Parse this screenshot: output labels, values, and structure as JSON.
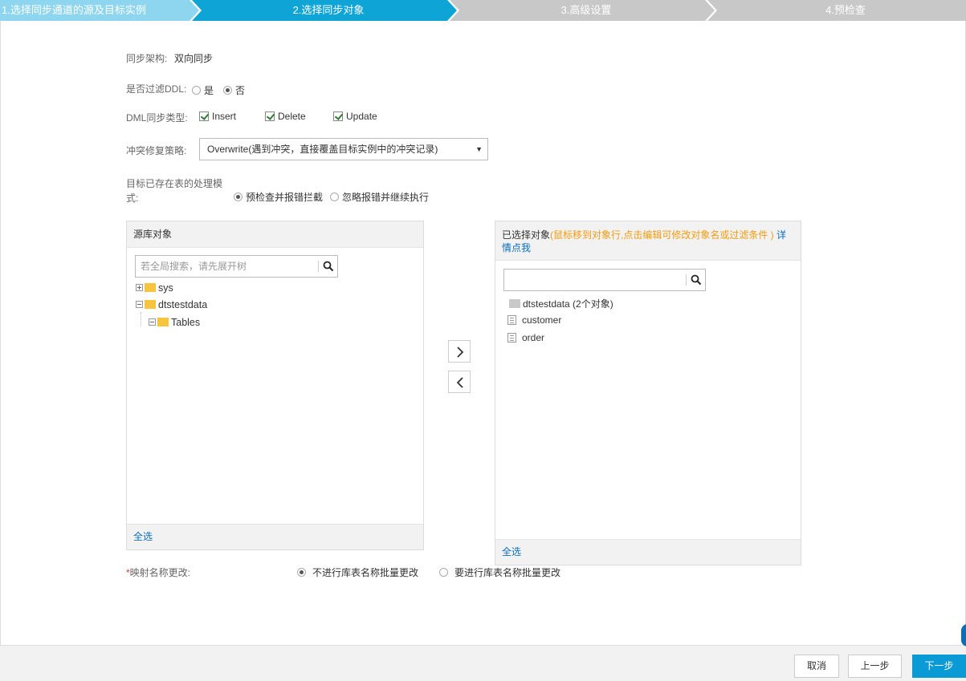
{
  "steps": [
    {
      "label": "1.选择同步通道的源及目标实例",
      "state": "done"
    },
    {
      "label": "2.选择同步对象",
      "state": "active"
    },
    {
      "label": "3.高级设置",
      "state": "todo"
    },
    {
      "label": "4.预检查",
      "state": "todo"
    }
  ],
  "colors": {
    "done": "#8ed5f0",
    "active": "#0ea4d6",
    "todo": "#c8c8c8",
    "link": "#0a6ebd",
    "hint": "#f39c12",
    "primary": "#0a9ad6"
  },
  "form": {
    "architecture_label": "同步架构:",
    "architecture_value": "双向同步",
    "ddl_label": "是否过滤DDL:",
    "ddl_options": [
      {
        "label": "是",
        "checked": false
      },
      {
        "label": "否",
        "checked": true
      }
    ],
    "dml_label": "DML同步类型:",
    "dml_options": [
      {
        "label": "Insert",
        "checked": true
      },
      {
        "label": "Delete",
        "checked": true
      },
      {
        "label": "Update",
        "checked": true
      }
    ],
    "conflict_label": "冲突修复策略:",
    "conflict_value": "Overwrite(遇到冲突，直接覆盖目标实例中的冲突记录)",
    "existing_table_label_line1": "目标已存在表的处理模",
    "existing_table_label_line2": "式:",
    "existing_table_options": [
      {
        "label": "预检查并报错拦截",
        "checked": true
      },
      {
        "label": "忽略报错并继续执行",
        "checked": false
      }
    ]
  },
  "source_panel": {
    "title": "源库对象",
    "search_placeholder": "若全局搜索，请先展开树",
    "tree": [
      {
        "label": "sys",
        "expanded": false
      },
      {
        "label": "dtstestdata",
        "expanded": true
      },
      {
        "label": "Tables",
        "expanded": true
      }
    ],
    "select_all": "全选"
  },
  "selected_panel": {
    "title": "已选择对象",
    "hint": "(鼠标移到对象行,点击编辑可修改对象名或过滤条件 )",
    "detail_link_part1": "详",
    "detail_link_part2": "情点我",
    "search_value": "",
    "tree": [
      {
        "label": "dtstestdata (2个对象)",
        "type": "folder"
      },
      {
        "label": "customer",
        "type": "table"
      },
      {
        "label": "order",
        "type": "table"
      }
    ],
    "select_all": "全选"
  },
  "mapping": {
    "required_mark": "*",
    "label": "映射名称更改:",
    "options": [
      {
        "label": "不进行库表名称批量更改",
        "checked": true
      },
      {
        "label": "要进行库表名称批量更改",
        "checked": false
      }
    ]
  },
  "footer": {
    "cancel": "取消",
    "prev": "上一步",
    "next": "下一步"
  }
}
